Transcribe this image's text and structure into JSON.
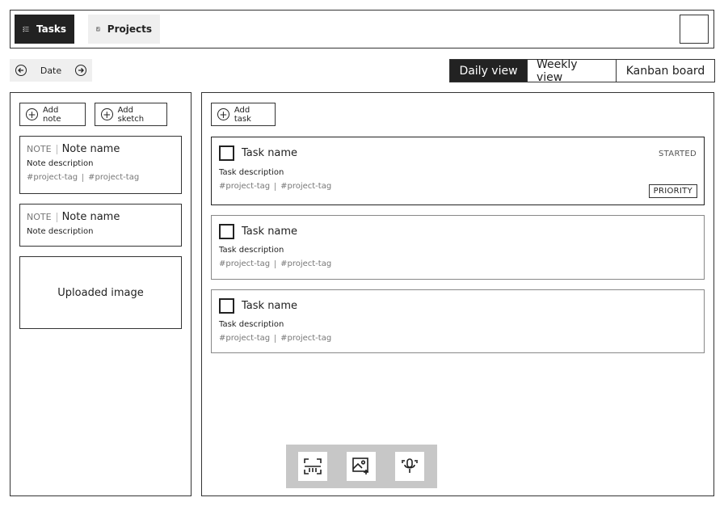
{
  "nav": {
    "tasks_label": "Tasks",
    "projects_label": "Projects"
  },
  "date_nav": {
    "label": "Date"
  },
  "views": {
    "daily": "Daily view",
    "weekly": "Weekly view",
    "kanban": "Kanban board",
    "active": "daily"
  },
  "left_panel": {
    "add_note_label": "Add note",
    "add_sketch_label": "Add sketch",
    "notes": [
      {
        "kind": "NOTE",
        "name": "Note name",
        "description": "Note description",
        "tags": [
          "#project-tag",
          "#project-tag"
        ]
      },
      {
        "kind": "NOTE",
        "name": "Note name",
        "description": "Note description"
      }
    ],
    "image_label": "Uploaded image"
  },
  "right_panel": {
    "add_task_label": "Add task",
    "tasks": [
      {
        "name": "Task name",
        "description": "Task description",
        "tags": [
          "#project-tag",
          "#project-tag"
        ],
        "status": "STARTED",
        "priority": "PRIORITY"
      },
      {
        "name": "Task name",
        "description": "Task description",
        "tags": [
          "#project-tag",
          "#project-tag"
        ]
      },
      {
        "name": "Task name",
        "description": "Task description",
        "tags": [
          "#project-tag",
          "#project-tag"
        ]
      }
    ]
  },
  "toolbar": {
    "tools": [
      "scan-icon",
      "add-image-icon",
      "microphone-icon"
    ]
  },
  "colors": {
    "dark": "#222222",
    "light_bg": "#efefef",
    "toolbar_bg": "#c7c7c7",
    "border": "#333333"
  }
}
